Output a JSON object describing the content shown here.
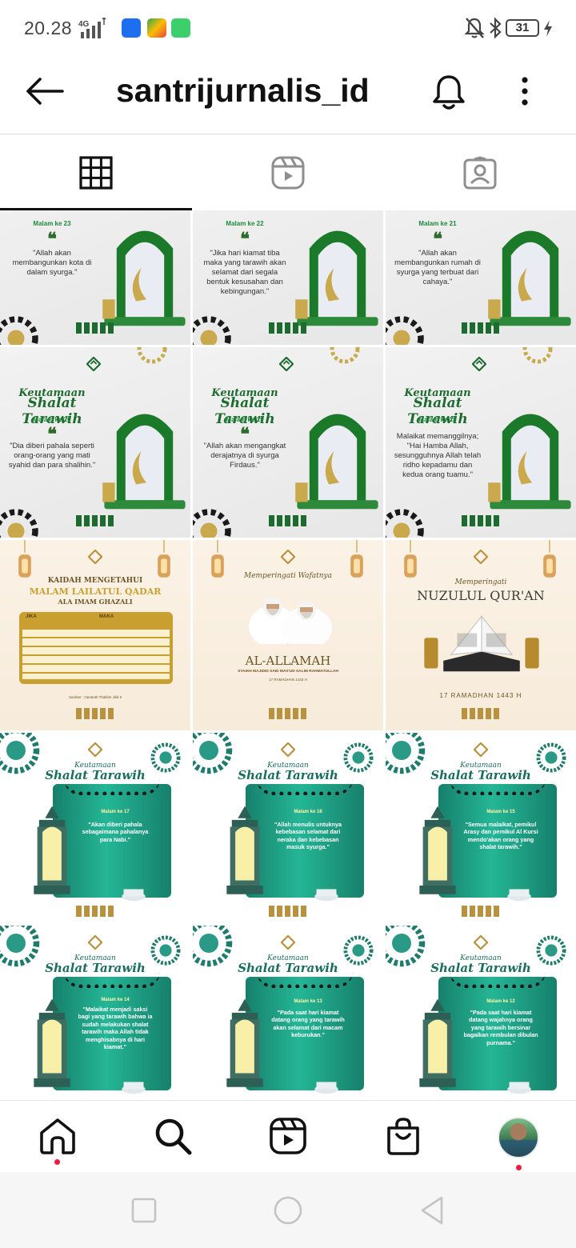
{
  "status_bar": {
    "time": "20.28",
    "network": "4G",
    "battery": "31"
  },
  "header": {
    "username": "santrijurnalis_id",
    "icons": [
      "back-arrow-icon",
      "bell-icon",
      "more-vert-icon"
    ]
  },
  "tabs": [
    {
      "name": "grid",
      "icon": "grid-icon",
      "active": true
    },
    {
      "name": "reels",
      "icon": "reels-icon",
      "active": false
    },
    {
      "name": "tagged",
      "icon": "tagged-icon",
      "active": false
    }
  ],
  "posts": {
    "row1": [
      {
        "night": "Malam ke 23",
        "quote": "\"Allah akan membangunkan kota di dalam syurga.\""
      },
      {
        "night": "Malam ke 22",
        "quote": "\"Jika hari kiamat tiba maka yang tarawih akan selamat dari segala bentuk kesusahan dan kebingungan.\""
      },
      {
        "night": "Malam ke 21",
        "quote": "\"Allah akan membangunkan rumah di syurga yang terbuat dari cahaya.\""
      }
    ],
    "row2": [
      {
        "heading1": "Keutamaan",
        "heading2": "Shalat Tarawih",
        "night": "Malam ke 20",
        "quote": "\"Dia diberi pahala seperti orang-orang yang mati syahid dan para shalihin.\""
      },
      {
        "heading1": "Keutamaan",
        "heading2": "Shalat Tarawih",
        "night": "Malam ke 19",
        "quote": "\"Allah akan mengangkat derajatnya di syurga Firdaus.\""
      },
      {
        "heading1": "Keutamaan",
        "heading2": "Shalat Tarawih",
        "night": "Malam ke 18",
        "quote": "Malaikat memanggilnya; \"Hai Hamba Allah, sesungguhnya Allah telah ridho kepadamu dan kedua orang tuamu.\""
      }
    ],
    "row3": [
      {
        "line1": "KAIDAH MENGETAHUI",
        "line2": "MALAM LAILATUL QADAR",
        "line3": "ALA IMAM GHAZALI",
        "col1": "JIKA",
        "col2": "MAKA",
        "source": "Sumber : I'anatuth Thalibin Jilid II"
      },
      {
        "script": "Memperingati Wafatnya",
        "name": "AL-ALLAMAH",
        "subtitle": "SYAIKH MAJIDID SAID MAS'UD SALIM RAHMATULLAH",
        "date": "17 RAMADHAN 1443 H"
      },
      {
        "script": "Memperingati",
        "title": "NUZULUL QUR'AN",
        "date": "17 RAMADHAN 1443 H"
      }
    ],
    "row4": [
      {
        "heading1": "Keutamaan",
        "heading2": "Shalat Tarawih",
        "night": "Malam ke 17",
        "quote": "\"Akan diberi pahala sebagaimana pahalanya para Nabi.\""
      },
      {
        "heading1": "Keutamaan",
        "heading2": "Shalat Tarawih",
        "night": "Malam ke 16",
        "quote": "\"Allah menulis untuknya kebebasan selamat dari neraka dan kebebasan masuk syurga.\""
      },
      {
        "heading1": "Keutamaan",
        "heading2": "Shalat Tarawih",
        "night": "Malam ke 15",
        "quote": "\"Semua malaikat, pemikul Arasy dan pemikul Al Kursi mendo'akan orang yang shalat tarawih.\""
      }
    ],
    "row5": [
      {
        "heading1": "Keutamaan",
        "heading2": "Shalat Tarawih",
        "night": "Malam ke 14",
        "quote": "\"Malaikat menjadi saksi bagi yang tarawih bahwa ia sudah melakukan shalat tarawih maka Allah tidak menghisabnya di hari kiamat.\""
      },
      {
        "heading1": "Keutamaan",
        "heading2": "Shalat Tarawih",
        "night": "Malam ke 13",
        "quote": "\"Pada saat hari kiamat datang orang yang tarawih akan selamat dari macam keburukan.\""
      },
      {
        "heading1": "Keutamaan",
        "heading2": "Shalat Tarawih",
        "night": "Malam ke 12",
        "quote": "\"Pada saat hari kiamat datang wajahnya orang yang tarawih bersinar bagaikan rembulan dibulan purnama.\""
      }
    ]
  },
  "bottom_nav": [
    {
      "name": "home",
      "icon": "home-icon"
    },
    {
      "name": "search",
      "icon": "search-icon"
    },
    {
      "name": "reels",
      "icon": "reels-icon"
    },
    {
      "name": "shop",
      "icon": "shop-bag-icon"
    },
    {
      "name": "profile",
      "icon": "profile-avatar"
    }
  ],
  "colors": {
    "accent_green": "#1d6b2f",
    "teal": "#1e9f86",
    "notification_dot": "#ed1c3c"
  }
}
